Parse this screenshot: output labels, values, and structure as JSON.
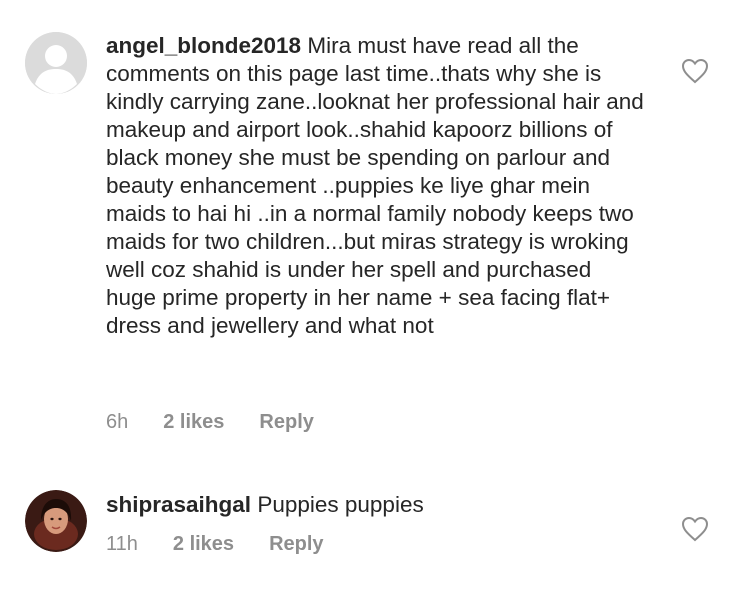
{
  "comments": [
    {
      "username": "angel_blonde2018",
      "text": "Mira must have read all the comments on this page last time..thats why she is kindly carrying zane..looknat her professional hair and makeup and airport look..shahid kapoorz billions of black money she must be spending on parlour and beauty enhancement ..puppies ke liye ghar mein maids to hai hi ..in a normal family nobody keeps two maids for two children...but miras strategy is wroking well coz shahid is under her spell and purchased huge prime property in her name + sea facing flat+ dress and jewellery and what not",
      "time": "6h",
      "likes": "2 likes",
      "reply": "Reply",
      "avatar_icon": "default-avatar-icon"
    },
    {
      "username": "shiprasaihgal",
      "text": "Puppies puppies",
      "time": "11h",
      "likes": "2 likes",
      "reply": "Reply",
      "avatar_icon": "user-photo-avatar"
    }
  ],
  "icons": {
    "like": "heart-outline-icon"
  },
  "colors": {
    "text": "#262626",
    "meta": "#8e8e8e",
    "avatar_placeholder": "#dbdbdb"
  }
}
